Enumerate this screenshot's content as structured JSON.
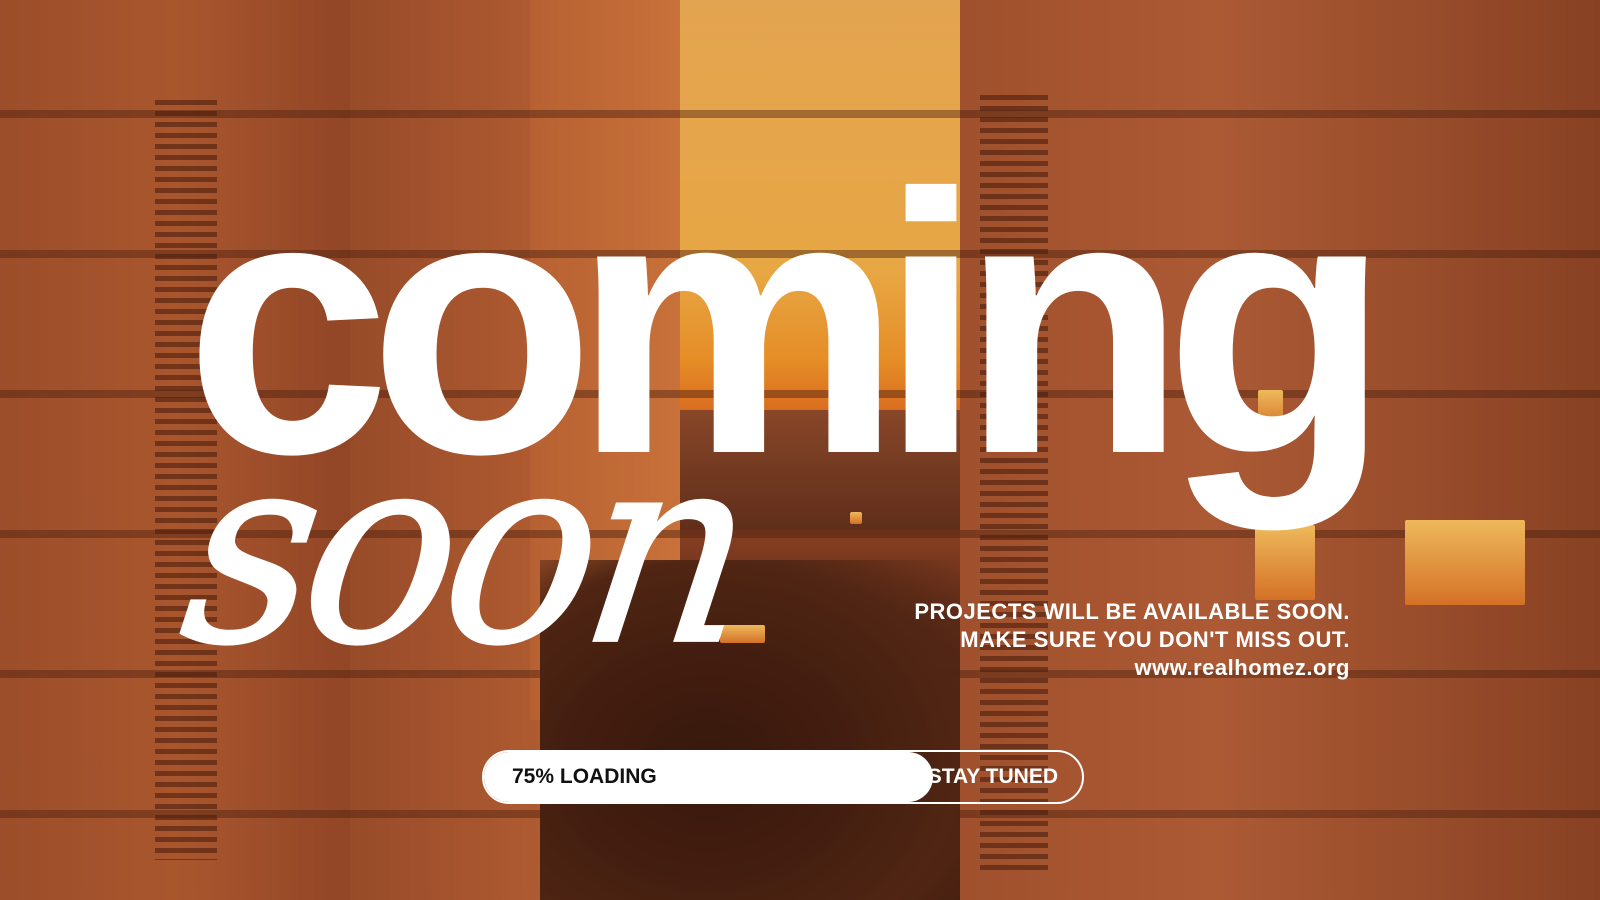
{
  "headline": {
    "primary": "coming",
    "secondary": "soon"
  },
  "tagline": {
    "line1": "PROJECTS WILL BE AVAILABLE SOON.",
    "line2": "MAKE SURE YOU DON'T MISS OUT.",
    "website": "www.realhomez.org"
  },
  "progress": {
    "label": "75% LOADING",
    "value_percent": 75,
    "cta_label": "STAY TUNED"
  },
  "colors": {
    "text": "#ffffff",
    "accent_sky": "#f59a2a",
    "building": "#a55530"
  }
}
